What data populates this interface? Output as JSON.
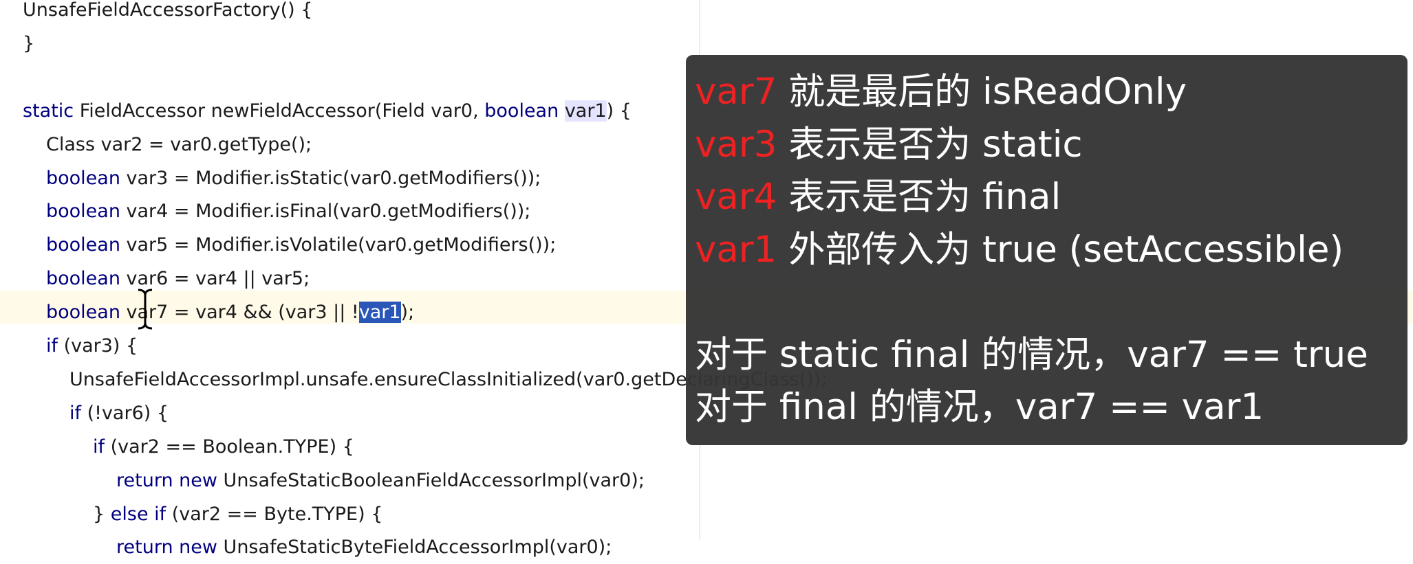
{
  "code": {
    "lines": [
      {
        "indent": 0,
        "parts": [
          {
            "t": "UnsafeFieldAccessorFactory() {"
          }
        ]
      },
      {
        "indent": 0,
        "parts": [
          {
            "t": "}"
          }
        ]
      },
      {
        "indent": 0,
        "parts": [
          {
            "t": ""
          }
        ]
      },
      {
        "indent": 0,
        "parts": [
          {
            "t": "static",
            "k": 1
          },
          {
            "t": " FieldAccessor newFieldAccessor(Field var0, "
          },
          {
            "t": "boolean",
            "k": 1
          },
          {
            "t": " "
          },
          {
            "t": "var1",
            "m": 1
          },
          {
            "t": ") {"
          }
        ]
      },
      {
        "indent": 1,
        "parts": [
          {
            "t": "Class var2 = var0.getType();"
          }
        ]
      },
      {
        "indent": 1,
        "parts": [
          {
            "t": "boolean",
            "k": 1
          },
          {
            "t": " var3 = Modifier.isStatic(var0.getModifiers());"
          }
        ]
      },
      {
        "indent": 1,
        "parts": [
          {
            "t": "boolean",
            "k": 1
          },
          {
            "t": " var4 = Modifier.isFinal(var0.getModifiers());"
          }
        ]
      },
      {
        "indent": 1,
        "parts": [
          {
            "t": "boolean",
            "k": 1
          },
          {
            "t": " var5 = Modifier.isVolatile(var0.getModifiers());"
          }
        ]
      },
      {
        "indent": 1,
        "parts": [
          {
            "t": "boolean",
            "k": 1
          },
          {
            "t": " var6 = var4 || var5;"
          }
        ]
      },
      {
        "indent": 1,
        "parts": [
          {
            "t": "boolean",
            "k": 1
          },
          {
            "t": " var7 = var4 && (var3 || !"
          },
          {
            "t": "var1",
            "s": 1
          },
          {
            "t": ");"
          }
        ]
      },
      {
        "indent": 1,
        "parts": [
          {
            "t": "if",
            "k": 1
          },
          {
            "t": " (var3) {"
          }
        ]
      },
      {
        "indent": 2,
        "parts": [
          {
            "t": "UnsafeFieldAccessorImpl.unsafe.ensureClassInitialized(var0.getDeclaringClass());"
          }
        ]
      },
      {
        "indent": 2,
        "parts": [
          {
            "t": "if",
            "k": 1
          },
          {
            "t": " (!var6) {"
          }
        ]
      },
      {
        "indent": 3,
        "parts": [
          {
            "t": "if",
            "k": 1
          },
          {
            "t": " (var2 == Boolean.TYPE) {"
          }
        ]
      },
      {
        "indent": 4,
        "parts": [
          {
            "t": "return",
            "k": 1
          },
          {
            "t": " "
          },
          {
            "t": "new",
            "k": 1
          },
          {
            "t": " UnsafeStaticBooleanFieldAccessorImpl(var0);"
          }
        ]
      },
      {
        "indent": 3,
        "parts": [
          {
            "t": "} "
          },
          {
            "t": "else",
            "k": 1
          },
          {
            "t": " "
          },
          {
            "t": "if",
            "k": 1
          },
          {
            "t": " (var2 == Byte.TYPE) {"
          }
        ]
      },
      {
        "indent": 4,
        "parts": [
          {
            "t": "return",
            "k": 1
          },
          {
            "t": " "
          },
          {
            "t": "new",
            "k": 1
          },
          {
            "t": " UnsafeStaticByteFieldAccessorImpl(var0);"
          }
        ]
      }
    ]
  },
  "overlay": {
    "lines": [
      {
        "red": "var7",
        "text": " 就是最后的 isReadOnly"
      },
      {
        "red": "var3",
        "text": " 表示是否为 static"
      },
      {
        "red": "var4",
        "text": " 表示是否为 final"
      },
      {
        "red": "var1",
        "text": " 外部传入为 true (setAccessible)"
      },
      {
        "red": "",
        "text": ""
      },
      {
        "red": "",
        "text": "对于 static final 的情况，var7 == true"
      },
      {
        "red": "",
        "text": "对于 final 的情况，var7 == var1"
      }
    ]
  },
  "colors": {
    "keyword": "#000080",
    "selection": "#2a56b8",
    "current_line": "#fffbe8",
    "overlay_bg": "#343434",
    "overlay_red": "#ee2222"
  },
  "icons": {
    "cursor": "text-ibeam-cursor-icon"
  }
}
